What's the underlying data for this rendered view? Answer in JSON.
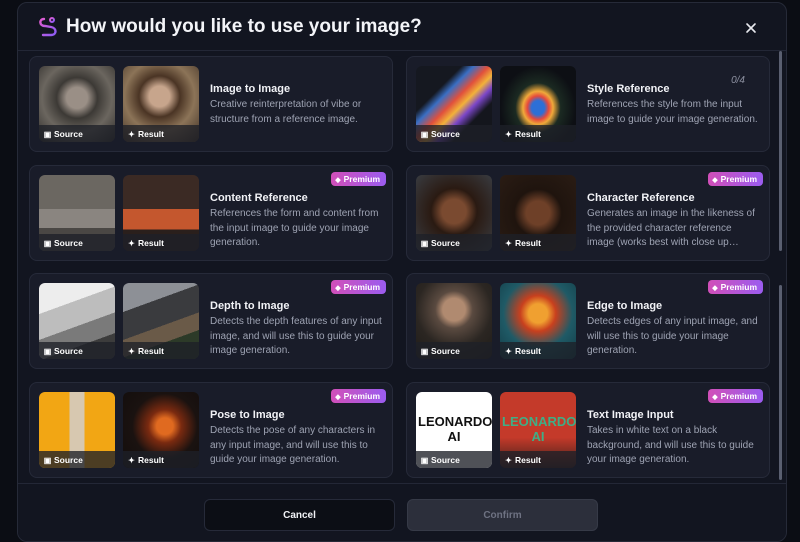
{
  "header": {
    "title": "How would you like to use your image?"
  },
  "labels": {
    "source": "Source",
    "result": "Result",
    "premium": "Premium"
  },
  "footer": {
    "cancel": "Cancel",
    "confirm": "Confirm"
  },
  "cards": [
    {
      "title": "Image to Image",
      "desc": "Creative reinterpretation of vibe or structure from a reference image.",
      "premium": false
    },
    {
      "title": "Style Reference",
      "desc": "References the style from the input image to guide your image generation.",
      "premium": false,
      "count": "0/4"
    },
    {
      "title": "Content Reference",
      "desc": "References the form and content from the input image to guide your image generation.",
      "premium": true
    },
    {
      "title": "Character Reference",
      "desc": "Generates an image in the likeness of the provided character reference image (works best with close up…",
      "premium": true
    },
    {
      "title": "Depth to Image",
      "desc": "Detects the depth features of any input image, and will use this to guide your image generation.",
      "premium": true
    },
    {
      "title": "Edge to Image",
      "desc": "Detects edges of any input image, and will use this to guide your image generation.",
      "premium": true
    },
    {
      "title": "Pose to Image",
      "desc": "Detects the pose of any characters in any input image, and will use this to guide your image generation.",
      "premium": true
    },
    {
      "title": "Text Image Input",
      "desc": "Takes in white text on a black background, and will use this to guide your image generation.",
      "premium": true,
      "thumb_text": "LEONARDO AI"
    }
  ],
  "colors": {
    "accent_gradient_start": "#d14fb8",
    "accent_gradient_end": "#9b5cf0",
    "modal_bg": "#121520",
    "card_bg": "#191c29"
  },
  "icons": {
    "logo": "leonardo-logo-icon",
    "close": "close-icon",
    "source": "image-icon",
    "result": "sparkle-icon",
    "premium": "gem-icon"
  }
}
